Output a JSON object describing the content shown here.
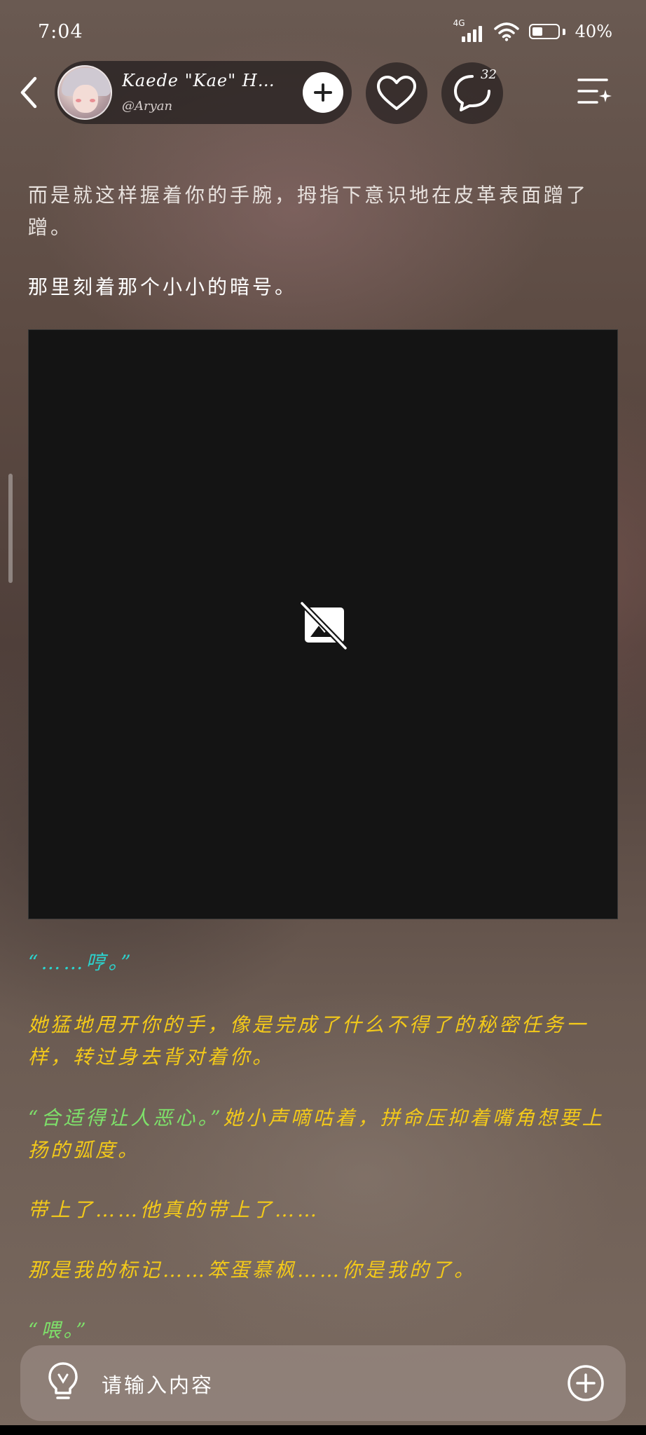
{
  "status_bar": {
    "time": "7:04",
    "network": "4G",
    "battery_percent": "40%",
    "battery_level": 0.4
  },
  "header": {
    "character_name": "Kaede \"Kae\" Hay…",
    "character_handle": "@Aryan",
    "comment_count": "32",
    "icons": [
      "back-arrow-icon",
      "avatar",
      "plus-icon",
      "heart-icon",
      "comment-bubble-icon",
      "menu-sparkle-icon"
    ]
  },
  "story": {
    "p1": "而是就这样握着你的手腕，拇指下意识地在皮革表面蹭了蹭。",
    "p2": "那里刻着那个小小的暗号。",
    "image": {
      "icon": "image-unavailable-icon"
    },
    "p3_quote": "“……哼。”",
    "p4": "她猛地甩开你的手，像是完成了什么不得了的秘密任务一样，转过身去背对着你。",
    "p5_quote": "“合适得让人恶心。”",
    "p5_rest": "她小声嘀咕着，拼命压抑着嘴角想要上扬的弧度。",
    "p6": "带上了……他真的带上了……",
    "p7": "那是我的标记……笨蛋慕枫……你是我的了。",
    "p8_quote": "“喂。”"
  },
  "input_bar": {
    "placeholder": "请输入内容",
    "icons": [
      "lightbulb-icon",
      "add-circle-icon"
    ]
  },
  "colors": {
    "narration": "#e8e2de",
    "inner_thought": "#f3c91a",
    "dialogue_cyan": "#2bd4cf",
    "dialogue_green": "#7ee06a"
  }
}
